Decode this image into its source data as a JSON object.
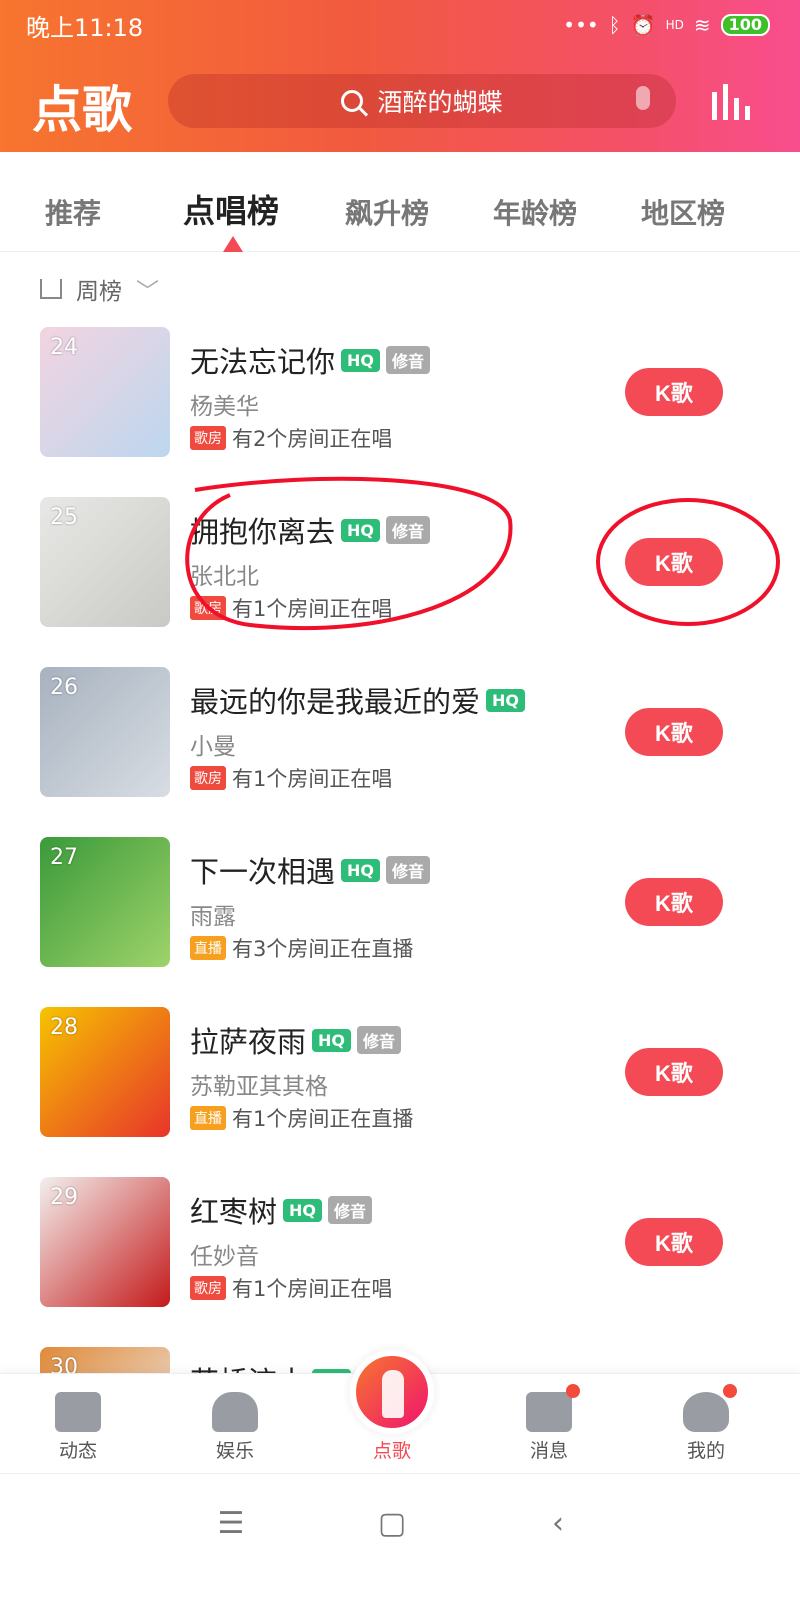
{
  "status": {
    "time": "晚上11:18",
    "battery": "100",
    "network": "HD"
  },
  "header": {
    "title": "点歌",
    "search_placeholder": "酒醉的蝴蝶"
  },
  "tabs": [
    {
      "label": "推荐"
    },
    {
      "label": "点唱榜",
      "active": true
    },
    {
      "label": "飙升榜"
    },
    {
      "label": "年龄榜"
    },
    {
      "label": "地区榜"
    }
  ],
  "filter": {
    "label": "周榜"
  },
  "songs": [
    {
      "rank": "24",
      "title": "无法忘记你",
      "hq": "HQ",
      "xiu": "修音",
      "artist": "杨美华",
      "tag": "歌房",
      "tag_color": "#f04a3e",
      "rooms": "有2个房间正在唱",
      "button": "K歌",
      "colors": [
        "#f3d4e0",
        "#bcd7ef"
      ]
    },
    {
      "rank": "25",
      "title": "拥抱你离去",
      "hq": "HQ",
      "xiu": "修音",
      "artist": "张北北",
      "tag": "歌房",
      "tag_color": "#f04a3e",
      "rooms": "有1个房间正在唱",
      "button": "K歌",
      "colors": [
        "#e8e8e6",
        "#c9c9c5"
      ]
    },
    {
      "rank": "26",
      "title": "最远的你是我最近的爱",
      "hq": "HQ",
      "xiu": "",
      "artist": "小曼",
      "tag": "歌房",
      "tag_color": "#f04a3e",
      "rooms": "有1个房间正在唱",
      "button": "K歌",
      "colors": [
        "#a7b2bf",
        "#d8dde3"
      ]
    },
    {
      "rank": "27",
      "title": "下一次相遇",
      "hq": "HQ",
      "xiu": "修音",
      "artist": "雨露",
      "tag": "直播",
      "tag_color": "#f7a020",
      "rooms": "有3个房间正在直播",
      "button": "K歌",
      "colors": [
        "#3a9a3a",
        "#9fd36a"
      ]
    },
    {
      "rank": "28",
      "title": "拉萨夜雨",
      "hq": "HQ",
      "xiu": "修音",
      "artist": "苏勒亚其其格",
      "tag": "直播",
      "tag_color": "#f7a020",
      "rooms": "有1个房间正在直播",
      "button": "K歌",
      "colors": [
        "#f5c400",
        "#e8342a"
      ]
    },
    {
      "rank": "29",
      "title": "红枣树",
      "hq": "HQ",
      "xiu": "修音",
      "artist": "任妙音",
      "tag": "歌房",
      "tag_color": "#f04a3e",
      "rooms": "有1个房间正在唱",
      "button": "K歌",
      "colors": [
        "#f2f0ee",
        "#c41a1a"
      ]
    },
    {
      "rank": "30",
      "title": "花桥流水",
      "hq": "HQ",
      "xiu": "",
      "artist": "",
      "tag": "",
      "tag_color": "#f04a3e",
      "rooms": "",
      "button": "",
      "colors": [
        "#e08a3a",
        "#eeeeee"
      ]
    }
  ],
  "bottom_nav": [
    {
      "label": "动态",
      "icon": "chat-icon"
    },
    {
      "label": "娱乐",
      "icon": "people-icon"
    },
    {
      "label": "点歌",
      "icon": "microphone-icon",
      "active": true
    },
    {
      "label": "消息",
      "icon": "mail-icon",
      "badge": true
    },
    {
      "label": "我的",
      "icon": "penguin-icon",
      "badge": true
    }
  ],
  "colors": {
    "accent": "#f34a55",
    "active_nav": "#f34a55",
    "hq": "#2ebd79"
  }
}
